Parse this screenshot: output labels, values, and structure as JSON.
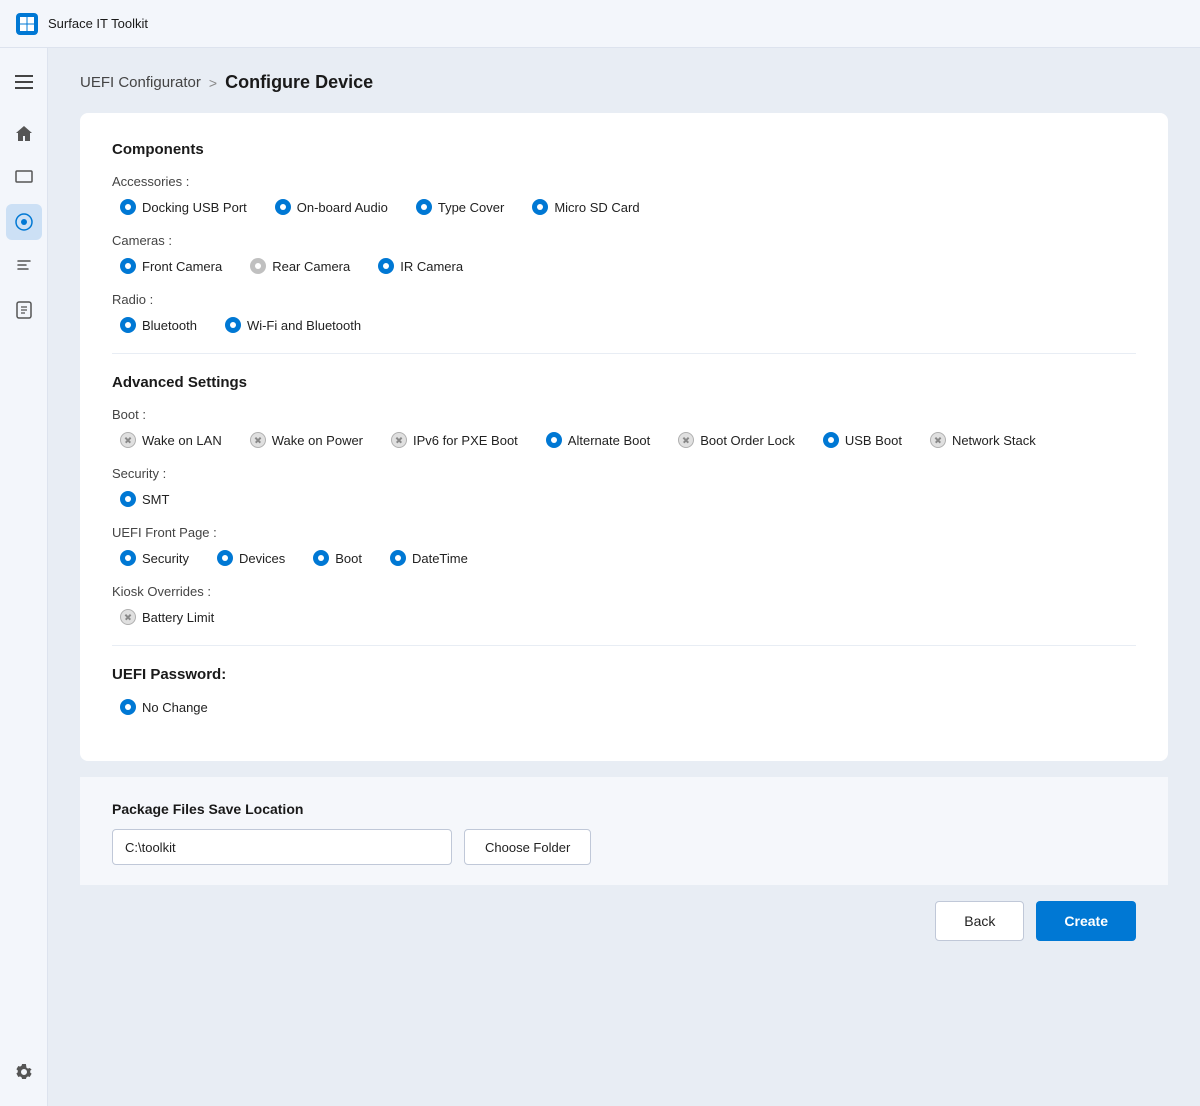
{
  "app": {
    "title": "Surface IT Toolkit",
    "icon_label": "S"
  },
  "breadcrumb": {
    "link": "UEFI Configurator",
    "separator": ">",
    "current": "Configure Device"
  },
  "sidebar": {
    "menu_icon": "hamburger",
    "items": [
      {
        "name": "home",
        "icon": "🏠",
        "active": false
      },
      {
        "name": "devices",
        "icon": "💻",
        "active": false
      },
      {
        "name": "uefi",
        "icon": "🔧",
        "active": true
      },
      {
        "name": "scripts",
        "icon": "📦",
        "active": false
      },
      {
        "name": "reports",
        "icon": "📋",
        "active": false
      }
    ],
    "settings": {
      "name": "settings",
      "icon": "⚙"
    }
  },
  "components": {
    "section_title": "Components",
    "accessories": {
      "label": "Accessories :",
      "items": [
        {
          "text": "Docking USB Port",
          "state": "blue"
        },
        {
          "text": "On-board Audio",
          "state": "blue"
        },
        {
          "text": "Type Cover",
          "state": "blue"
        },
        {
          "text": "Micro SD Card",
          "state": "blue"
        }
      ]
    },
    "cameras": {
      "label": "Cameras :",
      "items": [
        {
          "text": "Front Camera",
          "state": "blue"
        },
        {
          "text": "Rear Camera",
          "state": "gray"
        },
        {
          "text": "IR Camera",
          "state": "blue"
        }
      ]
    },
    "radio": {
      "label": "Radio :",
      "items": [
        {
          "text": "Bluetooth",
          "state": "blue"
        },
        {
          "text": "Wi-Fi and Bluetooth",
          "state": "blue"
        }
      ]
    }
  },
  "advanced": {
    "section_title": "Advanced Settings",
    "boot": {
      "label": "Boot :",
      "items": [
        {
          "text": "Wake on LAN",
          "state": "x"
        },
        {
          "text": "Wake on Power",
          "state": "x"
        },
        {
          "text": "IPv6 for PXE Boot",
          "state": "x"
        },
        {
          "text": "Alternate Boot",
          "state": "blue"
        },
        {
          "text": "Boot Order Lock",
          "state": "x"
        },
        {
          "text": "USB Boot",
          "state": "blue"
        },
        {
          "text": "Network Stack",
          "state": "x"
        }
      ]
    },
    "security": {
      "label": "Security :",
      "items": [
        {
          "text": "SMT",
          "state": "blue"
        }
      ]
    },
    "uefi_front_page": {
      "label": "UEFI Front Page :",
      "items": [
        {
          "text": "Security",
          "state": "blue"
        },
        {
          "text": "Devices",
          "state": "blue"
        },
        {
          "text": "Boot",
          "state": "blue"
        },
        {
          "text": "DateTime",
          "state": "blue"
        }
      ]
    },
    "kiosk_overrides": {
      "label": "Kiosk Overrides :",
      "items": [
        {
          "text": "Battery Limit",
          "state": "x"
        }
      ]
    }
  },
  "uefi_password": {
    "section_title": "UEFI Password:",
    "items": [
      {
        "text": "No Change",
        "state": "blue"
      }
    ]
  },
  "package_files": {
    "title": "Package Files Save Location",
    "path_value": "C:\\toolkit",
    "path_placeholder": "C:\\toolkit",
    "choose_folder_label": "Choose Folder"
  },
  "actions": {
    "back_label": "Back",
    "create_label": "Create"
  }
}
